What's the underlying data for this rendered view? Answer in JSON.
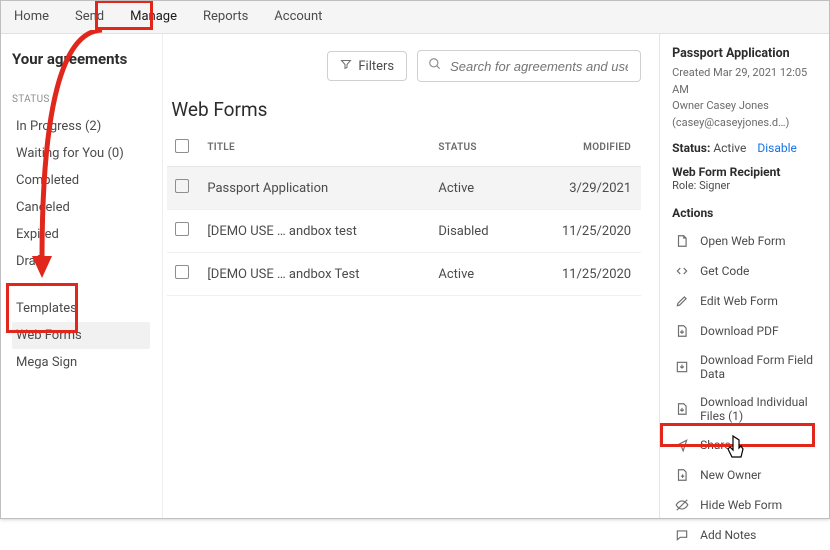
{
  "topnav": {
    "tabs": [
      "Home",
      "Send",
      "Manage",
      "Reports",
      "Account"
    ],
    "active": "Manage"
  },
  "left": {
    "heading": "Your agreements",
    "status_label": "STATUS",
    "status_items": [
      "In Progress (2)",
      "Waiting for You (0)",
      "Completed",
      "Canceled",
      "Expired",
      "Draft"
    ],
    "group2": [
      "Templates",
      "Web Forms",
      "Mega Sign"
    ],
    "group2_selected": "Web Forms"
  },
  "toolbar": {
    "filters_label": "Filters",
    "search_placeholder": "Search for agreements and users..."
  },
  "center": {
    "title": "Web Forms",
    "columns": {
      "title": "TITLE",
      "status": "STATUS",
      "modified": "MODIFIED"
    },
    "rows": [
      {
        "title": "Passport Application",
        "status": "Active",
        "modified": "3/29/2021",
        "selected": true
      },
      {
        "title": "[DEMO USE … andbox test",
        "status": "Disabled",
        "modified": "11/25/2020",
        "selected": false
      },
      {
        "title": "[DEMO USE … andbox Test",
        "status": "Active",
        "modified": "11/25/2020",
        "selected": false
      }
    ]
  },
  "right": {
    "title": "Passport Application",
    "created": "Created Mar 29, 2021 12:05 AM",
    "owner": "Owner Casey Jones (casey@caseyjones.d…)",
    "status_label": "Status:",
    "status_value": "Active",
    "disable_label": "Disable",
    "recipient_label": "Web Form Recipient",
    "recipient_role": "Role: Signer",
    "actions_label": "Actions",
    "actions": [
      "Open Web Form",
      "Get Code",
      "Edit Web Form",
      "Download PDF",
      "Download Form Field Data",
      "Download Individual Files (1)",
      "Share",
      "New Owner",
      "Hide Web Form",
      "Add Notes"
    ]
  }
}
